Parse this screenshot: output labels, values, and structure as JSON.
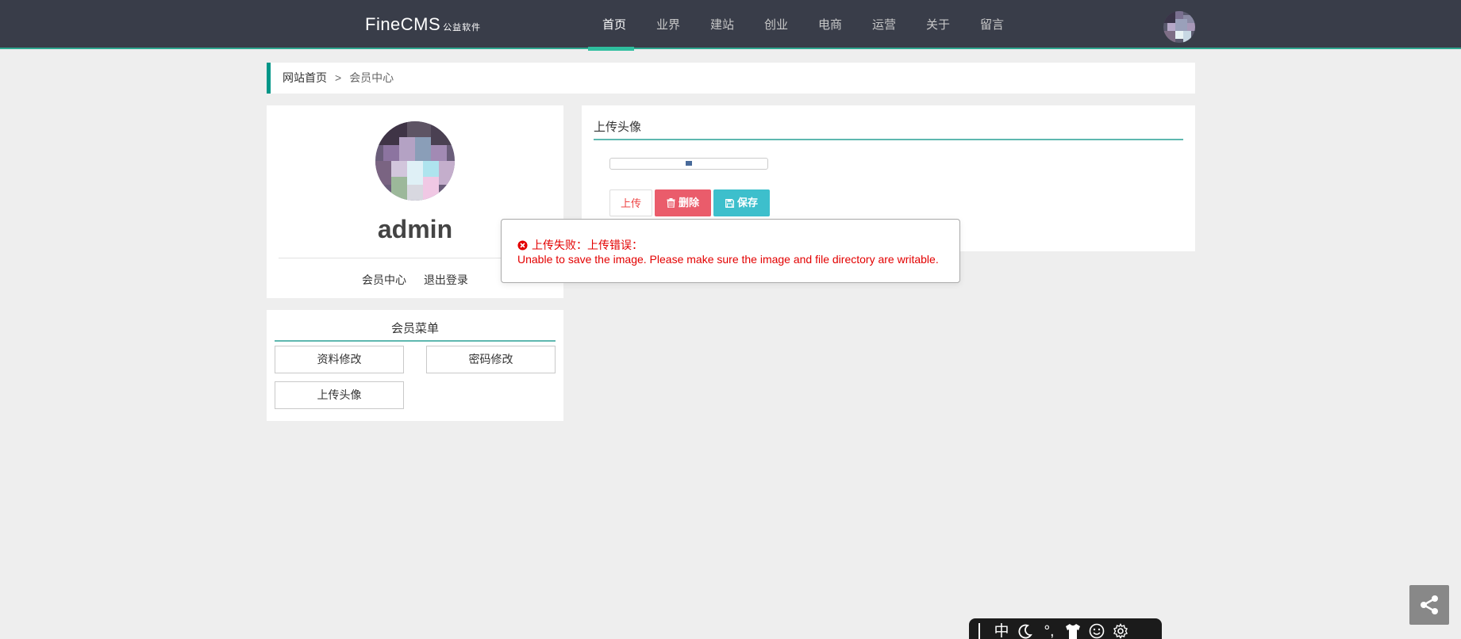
{
  "header": {
    "logo": "FineCMS",
    "logo_sub": "公益软件",
    "nav": [
      {
        "label": "首页",
        "active": true
      },
      {
        "label": "业界"
      },
      {
        "label": "建站"
      },
      {
        "label": "创业"
      },
      {
        "label": "电商"
      },
      {
        "label": "运营"
      },
      {
        "label": "关于"
      },
      {
        "label": "留言"
      }
    ]
  },
  "breadcrumb": {
    "home": "网站首页",
    "separator": ">",
    "current": "会员中心"
  },
  "user": {
    "name": "admin",
    "links": [
      "会员中心",
      "退出登录"
    ]
  },
  "menu": {
    "title": "会员菜单",
    "items": [
      "资料修改",
      "密码修改",
      "上传头像"
    ]
  },
  "panel": {
    "title": "上传头像",
    "buttons": {
      "upload": "上传",
      "delete": "删除",
      "save": "保存"
    }
  },
  "error": {
    "title": "上传失败：上传错误：",
    "message": "Unable to save the image. Please make sure the image and file directory are writable."
  },
  "ime": {
    "items": [
      "中",
      "moon-icon",
      "punctuation-icon",
      "shirt-icon",
      "smiley-icon",
      "gear-icon"
    ],
    "label_zh": "中",
    "label_punct": "°,"
  },
  "colors": {
    "header_bg": "#393d49",
    "accent": "#009688",
    "delete_btn": "#ea5c6b",
    "save_btn": "#3dbfcc",
    "error_text": "#e30000"
  }
}
